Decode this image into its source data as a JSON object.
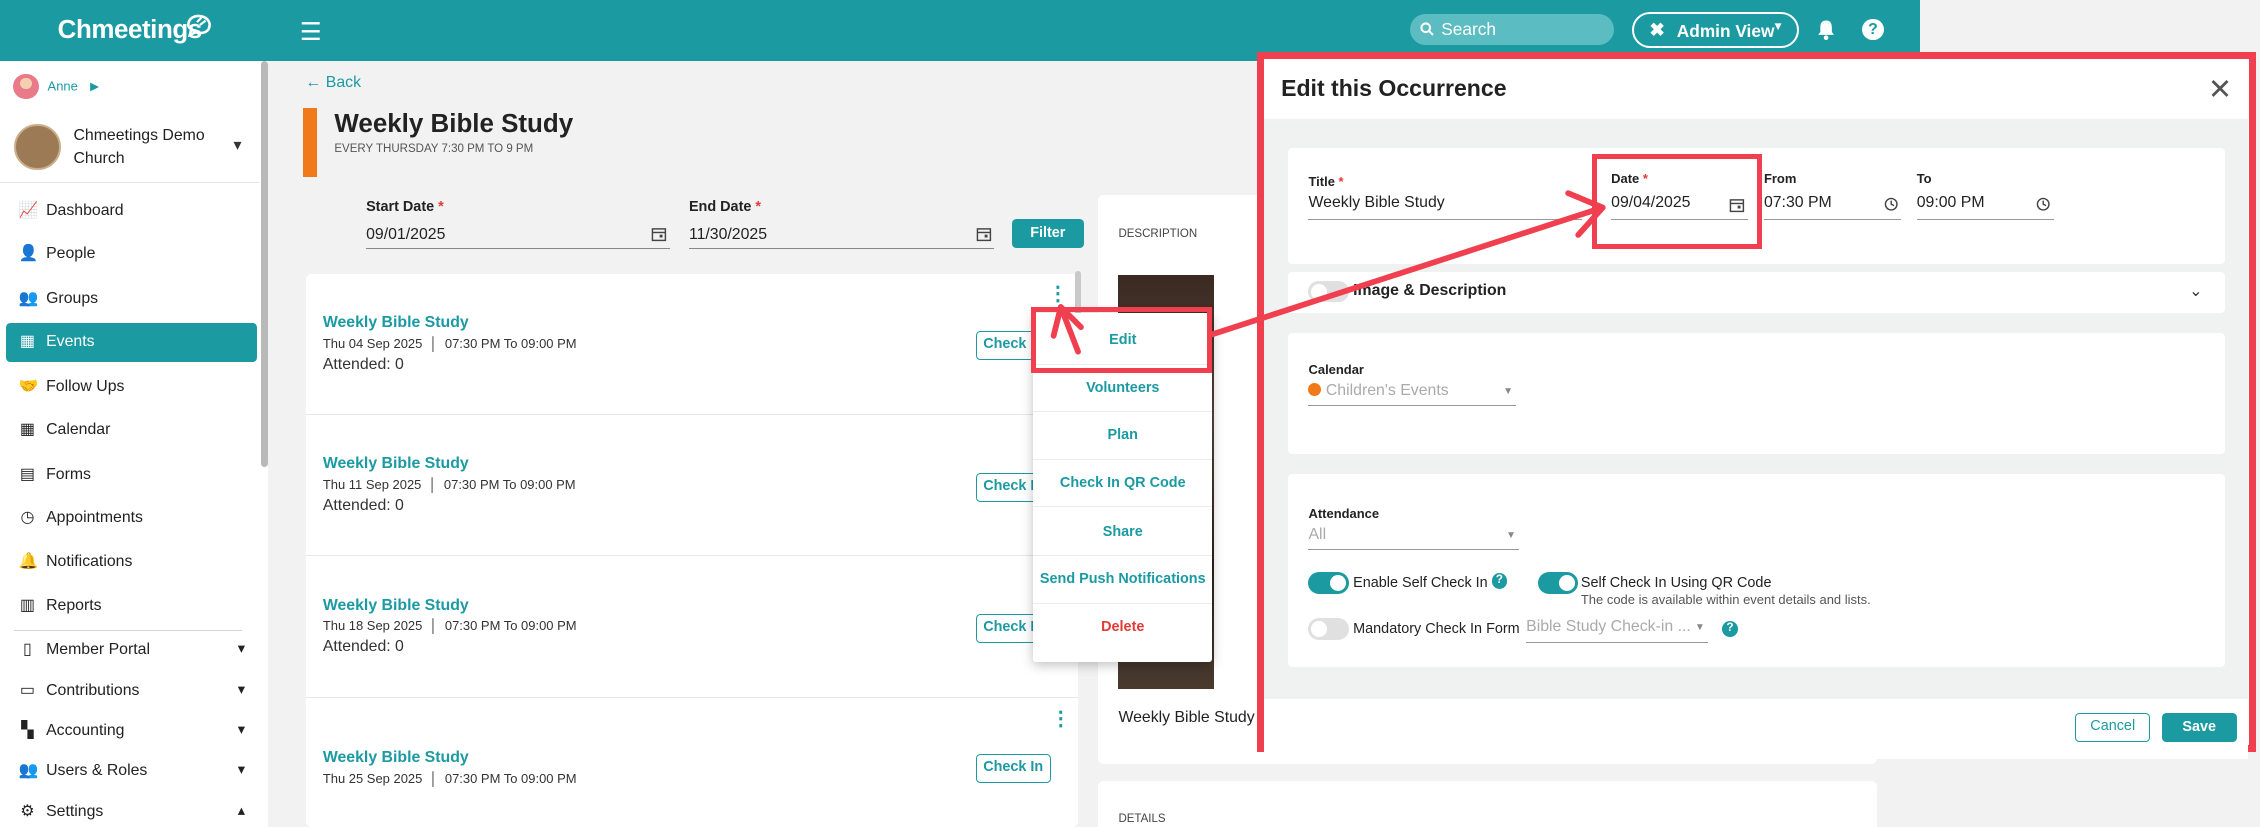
{
  "app": {
    "logo": "Chmeetings",
    "search_placeholder": "Search",
    "admin_view": "Admin View"
  },
  "sidebar": {
    "user_name": "Anne",
    "church_name": "Chmeetings Demo Church",
    "items": [
      {
        "label": "Dashboard",
        "icon": "dashboard-icon"
      },
      {
        "label": "People",
        "icon": "person-icon"
      },
      {
        "label": "Groups",
        "icon": "groups-icon"
      },
      {
        "label": "Events",
        "icon": "calendar-icon"
      },
      {
        "label": "Follow Ups",
        "icon": "handshake-icon"
      },
      {
        "label": "Calendar",
        "icon": "calendar-grid-icon"
      },
      {
        "label": "Forms",
        "icon": "form-icon"
      },
      {
        "label": "Appointments",
        "icon": "clock-icon"
      },
      {
        "label": "Notifications",
        "icon": "bell-icon"
      },
      {
        "label": "Reports",
        "icon": "report-icon"
      }
    ],
    "sections": [
      {
        "label": "Member Portal",
        "icon": "phone-icon"
      },
      {
        "label": "Contributions",
        "icon": "money-icon"
      },
      {
        "label": "Accounting",
        "icon": "accounting-icon"
      },
      {
        "label": "Users & Roles",
        "icon": "users-icon"
      },
      {
        "label": "Settings",
        "icon": "gear-icon"
      }
    ]
  },
  "page": {
    "back": "Back",
    "title": "Weekly Bible Study",
    "subtitle": "EVERY THURSDAY   7:30 PM TO 9 PM",
    "start_date_label": "Start Date",
    "start_date": "09/01/2025",
    "end_date_label": "End Date",
    "end_date": "11/30/2025",
    "filter": "Filter",
    "description_label": "DESCRIPTION",
    "description_title": "Weekly Bible Study",
    "details_label": "DETAILS"
  },
  "occurrences": [
    {
      "title": "Weekly Bible Study",
      "date": "Thu 04 Sep  2025",
      "time": "07:30 PM To 09:00 PM",
      "attended": "Attended: 0",
      "check_in": "Check In"
    },
    {
      "title": "Weekly Bible Study",
      "date": "Thu 11 Sep  2025",
      "time": "07:30 PM To 09:00 PM",
      "attended": "Attended: 0",
      "check_in": "Check In"
    },
    {
      "title": "Weekly Bible Study",
      "date": "Thu 18 Sep  2025",
      "time": "07:30 PM To 09:00 PM",
      "attended": "Attended: 0",
      "check_in": "Check In"
    },
    {
      "title": "Weekly Bible Study",
      "date": "Thu 25 Sep  2025",
      "time": "07:30 PM To 09:00 PM",
      "attended": "",
      "check_in": "Check In"
    }
  ],
  "context_menu": [
    "Edit",
    "Volunteers",
    "Plan",
    "Check In QR Code",
    "Share",
    "Send Push Notifications",
    "Delete"
  ],
  "edit_panel": {
    "title": "Edit this Occurrence",
    "title_label": "Title",
    "title_value": "Weekly Bible Study",
    "date_label": "Date",
    "date_value": "09/04/2025",
    "from_label": "From",
    "from_value": "07:30 PM",
    "to_label": "To",
    "to_value": "09:00 PM",
    "image_desc": "Image & Description",
    "calendar_label": "Calendar",
    "calendar_value": "Children's Events",
    "attendance_label": "Attendance",
    "attendance_value": "All",
    "self_checkin": "Enable Self Check In",
    "qr_checkin": "Self Check In Using QR Code",
    "qr_note": "The code is available within event details and lists.",
    "mandatory": "Mandatory Check In Form",
    "form_value": "Bible Study Check-in ...",
    "cancel": "Cancel",
    "save": "Save"
  },
  "colors": {
    "brand": "#1b9aa2",
    "accent": "#f07a19",
    "annotation": "#f04050",
    "danger": "#e53935"
  }
}
